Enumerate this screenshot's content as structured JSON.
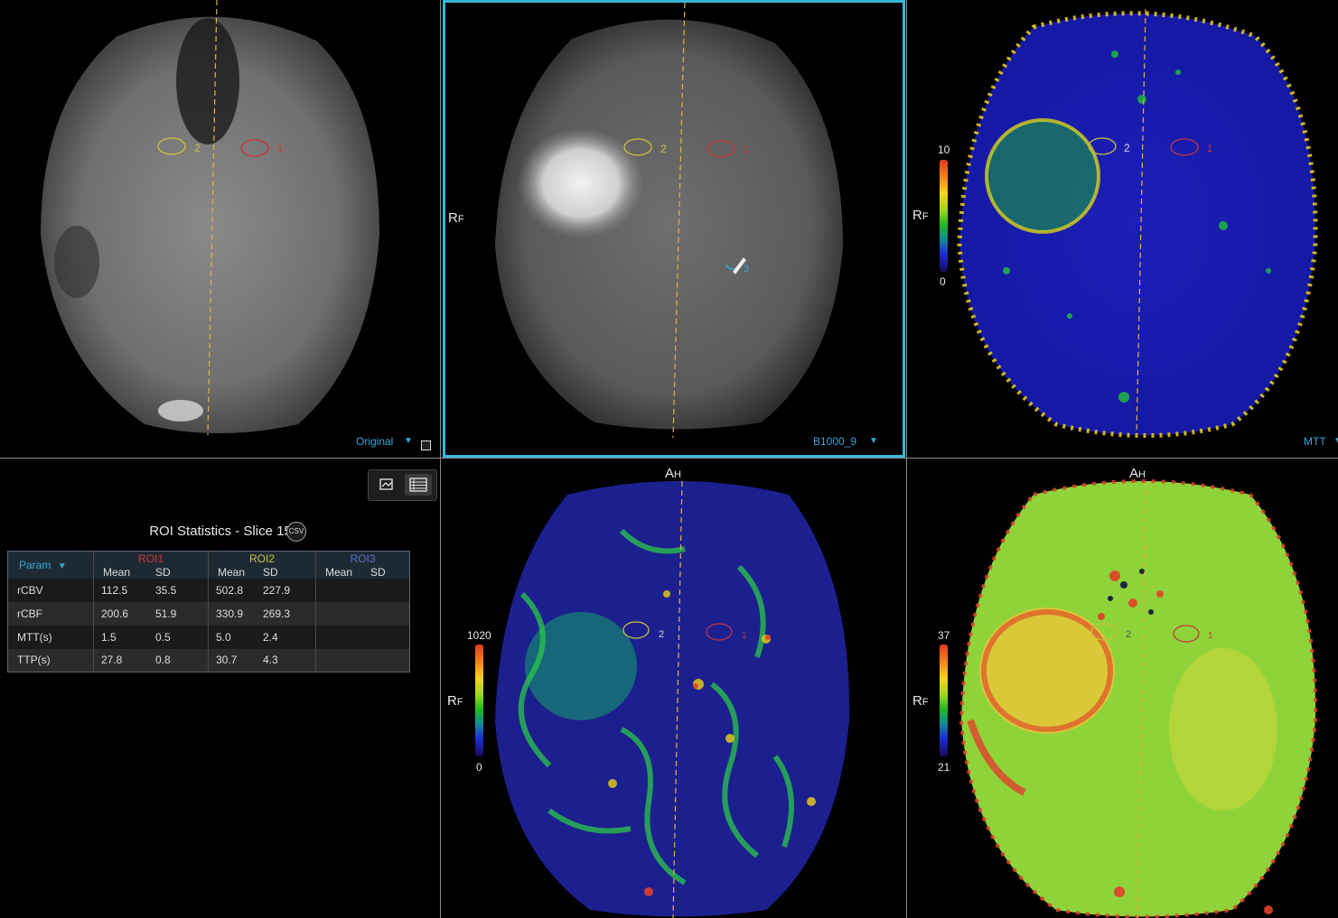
{
  "viewports": {
    "top_left": {
      "series_label": "Original"
    },
    "top_middle": {
      "series_label": "B1000_9",
      "orientation_left": "R",
      "orientation_left_sub": "F"
    },
    "top_right": {
      "series_label": "MTT",
      "orientation_left": "R",
      "orientation_left_sub": "F",
      "colorbar_max": "10",
      "colorbar_min": "0"
    },
    "bottom_middle": {
      "orientation_top": "A",
      "orientation_top_sub": "H",
      "orientation_left": "R",
      "orientation_left_sub": "F",
      "colorbar_max": "1020",
      "colorbar_min": "0"
    },
    "bottom_right": {
      "orientation_top": "A",
      "orientation_top_sub": "H",
      "orientation_left": "R",
      "orientation_left_sub": "F",
      "colorbar_max": "37",
      "colorbar_min": "21"
    }
  },
  "roi_labels": {
    "roi1": "1",
    "roi2": "2",
    "roi3": "3"
  },
  "roi_colors": {
    "roi1": "#c8343a",
    "roi2": "#c9c23a",
    "roi3": "#3aa6d8"
  },
  "stats": {
    "title": "ROI Statistics - Slice 15",
    "csv_icon": "CSV",
    "param_header": "Param",
    "rois": [
      "ROI1",
      "ROI2",
      "ROI3"
    ],
    "mean_label": "Mean",
    "sd_label": "SD",
    "rows": [
      {
        "param": "rCBV",
        "roi1_mean": "112.5",
        "roi1_sd": "35.5",
        "roi2_mean": "502.8",
        "roi2_sd": "227.9"
      },
      {
        "param": "rCBF",
        "roi1_mean": "200.6",
        "roi1_sd": "51.9",
        "roi2_mean": "330.9",
        "roi2_sd": "269.3"
      },
      {
        "param": "MTT(s)",
        "roi1_mean": "1.5",
        "roi1_sd": "0.5",
        "roi2_mean": "5.0",
        "roi2_sd": "2.4"
      },
      {
        "param": "TTP(s)",
        "roi1_mean": "27.8",
        "roi1_sd": "0.8",
        "roi2_mean": "30.7",
        "roi2_sd": "4.3"
      }
    ]
  },
  "toolbar": {
    "graph_icon": "graph-view-icon",
    "table_icon": "table-view-icon"
  },
  "colors": {
    "accent": "#3aa6d8",
    "selected_border": "#35b8d8",
    "midline": "#e3b341"
  }
}
